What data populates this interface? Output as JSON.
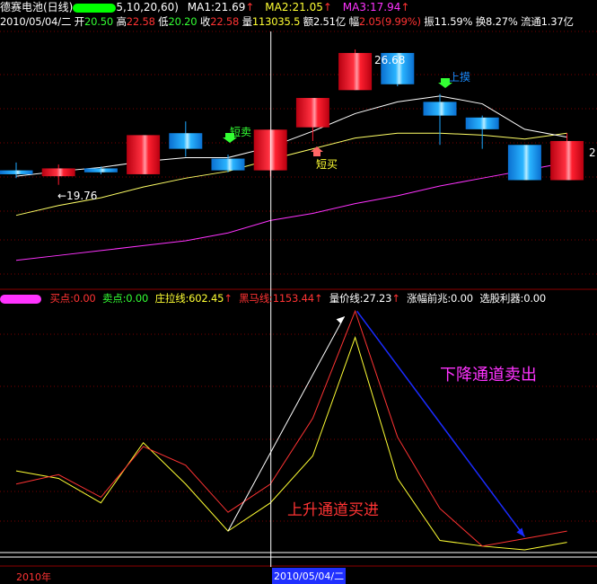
{
  "colors": {
    "bg": "#000000",
    "grid": "#7a0000",
    "up": "#ff1a2e",
    "down": "#1ea8ff",
    "ma1": "#ffffff",
    "ma2": "#ffff66",
    "ma3": "#ff33ff",
    "white": "#ffffff",
    "yellow": "#ffff33",
    "red": "#ff3333",
    "green": "#33ff33",
    "magenta": "#ff33ff",
    "blue": "#1a2bff"
  },
  "header1": {
    "name": "德赛电池(日线)",
    "params": "5,10,20,60)",
    "ma1_label": "MA1:21.69",
    "ma2_label": "MA2:21.05",
    "ma3_label": "MA3:17.94",
    "arrow": "↑"
  },
  "header2": {
    "date": "2010/05/04/二",
    "open_label": "开",
    "open": "20.50",
    "high_label": "高",
    "high": "22.58",
    "low_label": "低",
    "low": "20.20",
    "close_label": "收",
    "close": "22.58",
    "vol_label": "量",
    "vol": "113035.5",
    "amt_label": "额",
    "amt": "2.51亿",
    "chg_label": "幅",
    "chg": "2.05(9.99%)",
    "amp_label": "振",
    "amp": "11.59%",
    "turn_label": "换",
    "turn": "8.27%",
    "float_label": "流通",
    "float": "1.37亿"
  },
  "ind_header": {
    "buy": "买点:0.00",
    "sell": "卖点:0.00",
    "zhuang": "庄拉线:602.45",
    "heima": "黑马线:1153.44",
    "liangjia": "量价线:27.23",
    "zhangfu": "涨幅前兆:0.00",
    "xuangu": "选股利器:0.00",
    "arrow": "↑"
  },
  "annotations": {
    "high_price": "26.68",
    "low_price": "←19.76",
    "short_sell": "短卖",
    "short_buy": "短买",
    "top_escape": "上摸",
    "right_price": "2",
    "down_channel": "下降通道卖出",
    "up_channel": "上升通道买进"
  },
  "footer": {
    "year": "2010年",
    "cursor_date": "2010/05/04/二"
  },
  "chart_data": [
    {
      "type": "candlestick",
      "candles": [
        {
          "o": 20.5,
          "h": 20.9,
          "l": 20.1,
          "c": 20.3
        },
        {
          "o": 20.2,
          "h": 20.8,
          "l": 19.76,
          "c": 20.6
        },
        {
          "o": 20.6,
          "h": 20.7,
          "l": 20.3,
          "c": 20.4
        },
        {
          "o": 20.3,
          "h": 22.3,
          "l": 20.3,
          "c": 22.3
        },
        {
          "o": 22.4,
          "h": 23.0,
          "l": 21.2,
          "c": 21.6
        },
        {
          "o": 21.1,
          "h": 21.3,
          "l": 20.4,
          "c": 20.5
        },
        {
          "o": 20.5,
          "h": 22.58,
          "l": 20.2,
          "c": 22.58
        },
        {
          "o": 22.7,
          "h": 24.2,
          "l": 22.0,
          "c": 24.2
        },
        {
          "o": 24.6,
          "h": 26.68,
          "l": 24.6,
          "c": 26.5
        },
        {
          "o": 26.5,
          "h": 26.5,
          "l": 24.8,
          "c": 24.9
        },
        {
          "o": 24.0,
          "h": 24.4,
          "l": 21.8,
          "c": 23.3
        },
        {
          "o": 23.2,
          "h": 23.3,
          "l": 21.6,
          "c": 22.6
        },
        {
          "o": 21.8,
          "h": 21.8,
          "l": 20.0,
          "c": 20.0
        },
        {
          "o": 20.0,
          "h": 22.4,
          "l": 20.0,
          "c": 22.0
        }
      ],
      "ma1": [
        20.2,
        20.45,
        20.65,
        20.95,
        21.15,
        21.15,
        21.69,
        22.5,
        23.4,
        24.0,
        24.3,
        23.9,
        22.6,
        22.2
      ],
      "ma2": [
        18.2,
        18.7,
        19.1,
        19.65,
        20.1,
        20.45,
        21.05,
        21.6,
        22.15,
        22.4,
        22.4,
        22.3,
        22.1,
        22.4
      ],
      "ma3": [
        15.9,
        16.15,
        16.4,
        16.65,
        16.9,
        17.3,
        17.94,
        18.3,
        18.8,
        19.2,
        19.7,
        20.1,
        20.5,
        20.9
      ],
      "ylim": [
        15.2,
        27.6
      ]
    },
    {
      "type": "line",
      "series": [
        {
          "name": "黑马线",
          "values": [
            35,
            40,
            28,
            55,
            45,
            20,
            35,
            70,
            127,
            60,
            22,
            2,
            6,
            10
          ]
        },
        {
          "name": "量价线",
          "values": [
            42,
            38,
            25,
            57,
            35,
            10,
            25,
            50,
            113,
            38,
            5,
            2,
            0,
            4
          ]
        }
      ],
      "markers": {
        "cursor_index": 6
      },
      "ylim": [
        0,
        130
      ]
    }
  ]
}
